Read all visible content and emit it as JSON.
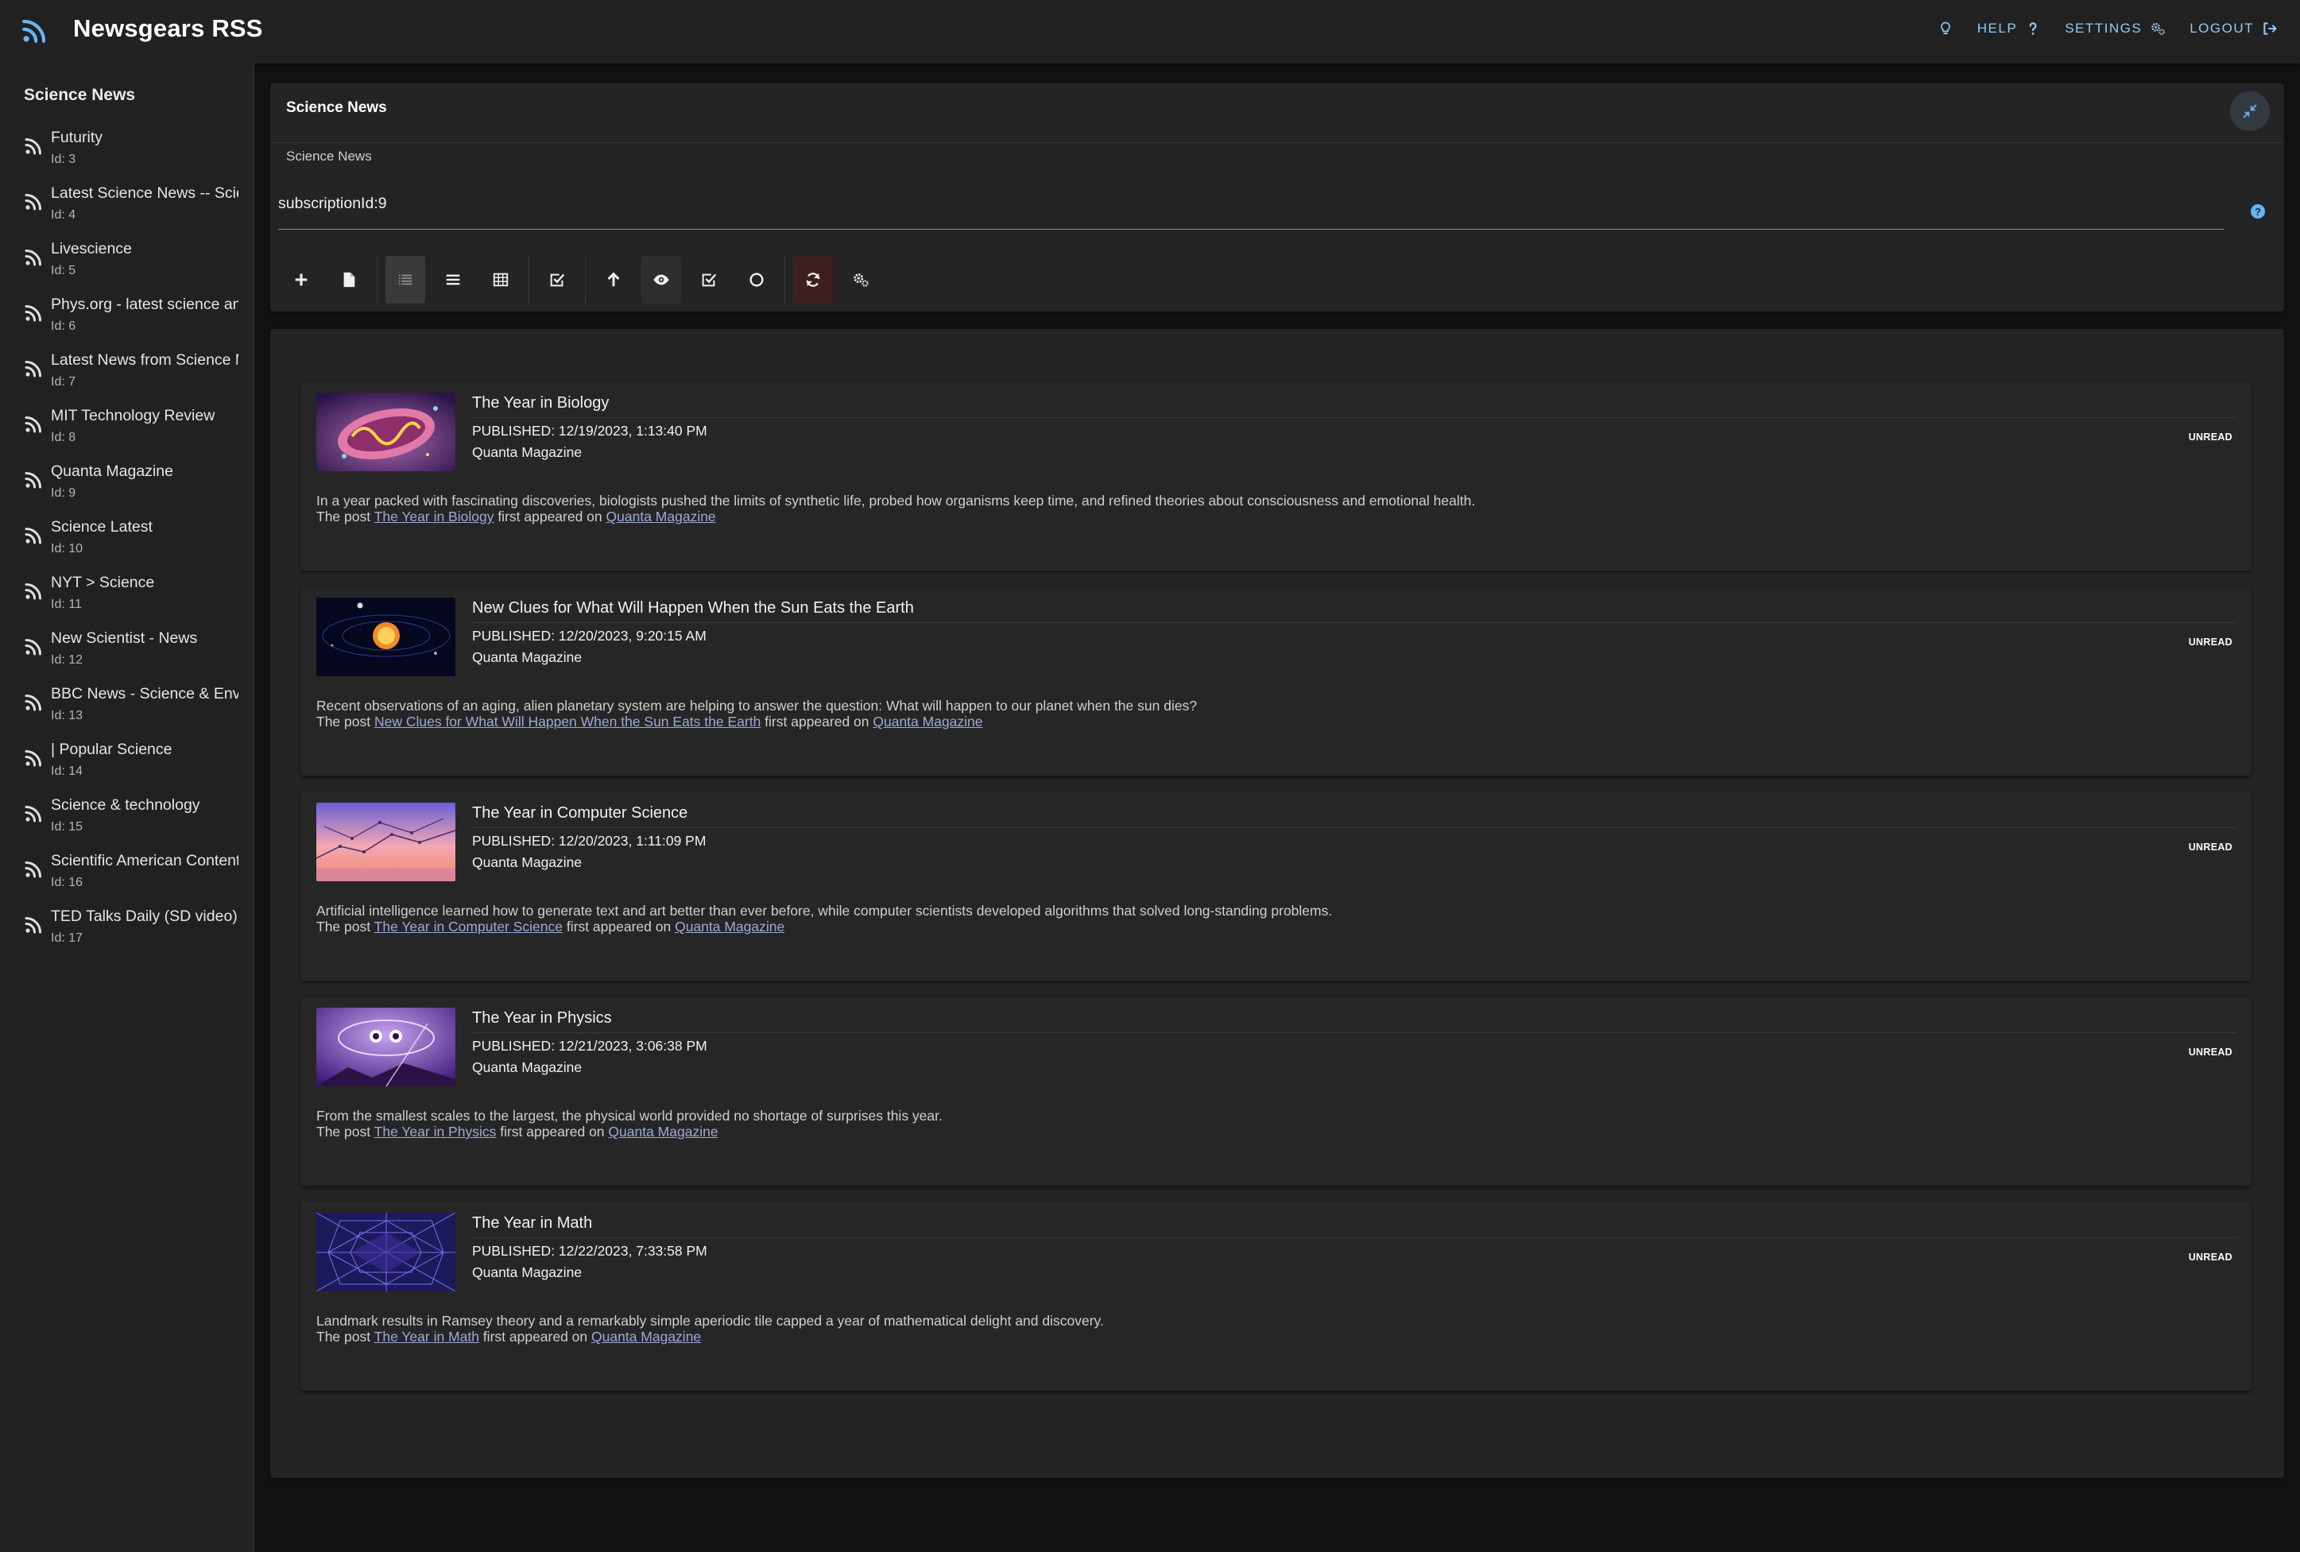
{
  "app": {
    "title": "Newsgears RSS"
  },
  "nav": {
    "help": "HELP",
    "settings": "SETTINGS",
    "logout": "LOGOUT"
  },
  "sidebar": {
    "title": "Science News",
    "feeds": [
      {
        "name": "Futurity",
        "id": "Id: 3"
      },
      {
        "name": "Latest Science News -- ScienceDaily",
        "id": "Id: 4"
      },
      {
        "name": "Livescience",
        "id": "Id: 5"
      },
      {
        "name": "Phys.org - latest science and technology news",
        "id": "Id: 6"
      },
      {
        "name": "Latest News from Science Magazine",
        "id": "Id: 7"
      },
      {
        "name": "MIT Technology Review",
        "id": "Id: 8"
      },
      {
        "name": "Quanta Magazine",
        "id": "Id: 9"
      },
      {
        "name": "Science Latest",
        "id": "Id: 10"
      },
      {
        "name": "NYT > Science",
        "id": "Id: 11"
      },
      {
        "name": "New Scientist - News",
        "id": "Id: 12"
      },
      {
        "name": "BBC News - Science & Environment",
        "id": "Id: 13"
      },
      {
        "name": "| Popular Science",
        "id": "Id: 14"
      },
      {
        "name": "Science & technology",
        "id": "Id: 15"
      },
      {
        "name": "Scientific American Content",
        "id": "Id: 16"
      },
      {
        "name": "TED Talks Daily (SD video)",
        "id": "Id: 17"
      }
    ]
  },
  "header": {
    "title": "Science News",
    "subtitle": "Science News",
    "query_value": "subscriptionId:9",
    "help_glyph": "?"
  },
  "articles": [
    {
      "title": "The Year in Biology",
      "published": "PUBLISHED: 12/19/2023, 1:13:40 PM",
      "source": "Quanta Magazine",
      "status": "UNREAD",
      "description": "In a year packed with fascinating discoveries, biologists pushed the limits of synthetic life, probed how organisms keep time, and refined theories about consciousness and emotional health.",
      "post_prefix": "The post ",
      "post_link": "The Year in Biology",
      "post_middle": " first appeared on ",
      "source_link": "Quanta Magazine"
    },
    {
      "title": "New Clues for What Will Happen When the Sun Eats the Earth",
      "published": "PUBLISHED: 12/20/2023, 9:20:15 AM",
      "source": "Quanta Magazine",
      "status": "UNREAD",
      "description": "Recent observations of an aging, alien planetary system are helping to answer the question: What will happen to our planet when the sun dies?",
      "post_prefix": "The post ",
      "post_link": "New Clues for What Will Happen When the Sun Eats the Earth",
      "post_middle": " first appeared on ",
      "source_link": "Quanta Magazine"
    },
    {
      "title": "The Year in Computer Science",
      "published": "PUBLISHED: 12/20/2023, 1:11:09 PM",
      "source": "Quanta Magazine",
      "status": "UNREAD",
      "description": "Artificial intelligence learned how to generate text and art better than ever before, while computer scientists developed algorithms that solved long-standing problems.",
      "post_prefix": "The post ",
      "post_link": "The Year in Computer Science",
      "post_middle": " first appeared on ",
      "source_link": "Quanta Magazine"
    },
    {
      "title": "The Year in Physics",
      "published": "PUBLISHED: 12/21/2023, 3:06:38 PM",
      "source": "Quanta Magazine",
      "status": "UNREAD",
      "description": "From the smallest scales to the largest, the physical world provided no shortage of surprises this year.",
      "post_prefix": "The post ",
      "post_link": "The Year in Physics",
      "post_middle": " first appeared on ",
      "source_link": "Quanta Magazine"
    },
    {
      "title": "The Year in Math",
      "published": "PUBLISHED: 12/22/2023, 7:33:58 PM",
      "source": "Quanta Magazine",
      "status": "UNREAD",
      "description": "Landmark results in Ramsey theory and a remarkably simple aperiodic tile capped a year of mathematical delight and discovery.",
      "post_prefix": "The post ",
      "post_link": "The Year in Math",
      "post_middle": " first appeared on ",
      "source_link": "Quanta Magazine"
    }
  ],
  "icons": {
    "logo": "rss-icon",
    "feed": "rss-icon",
    "help": "lightbulb-icon",
    "settings": "cogs-icon",
    "logout": "sign-out-icon",
    "collapse": "compress-icon"
  },
  "colors": {
    "accent": "#90caf9",
    "link": "#9fa8da",
    "background": "#121212",
    "panel": "#242424"
  }
}
